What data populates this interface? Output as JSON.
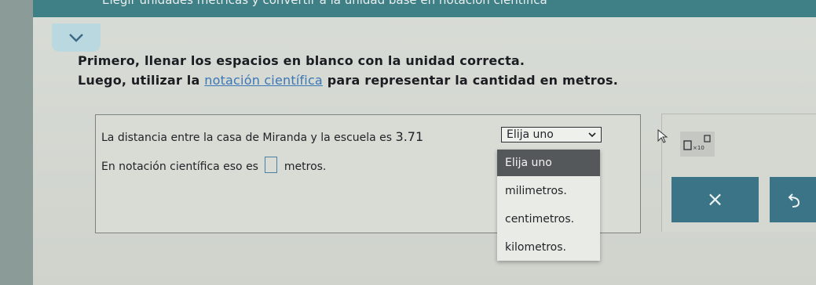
{
  "header": {
    "title": "Elegir unidades métricas y convertir a la unidad base en notación científica"
  },
  "instructions": {
    "line1": "Primero, llenar los espacios en blanco con la unidad correcta.",
    "line2_before": "Luego, utilizar la ",
    "line2_link": "notación científica",
    "line2_after": " para representar la cantidad en metros."
  },
  "question": {
    "sentence1": "La distancia entre la casa de Miranda y la escuela es ",
    "number": "3.71",
    "sentence2_before": "En notación científica eso es ",
    "sentence2_after": " metros."
  },
  "unit_select": {
    "value": "Elija uno",
    "options": [
      "Elija uno",
      "milimetros.",
      "centimetros.",
      "kilometros."
    ]
  },
  "tools": {
    "clear_label": "×"
  },
  "colors": {
    "header": "#3f7f86",
    "accent_button": "#3a7486",
    "link": "#3b76b5"
  }
}
